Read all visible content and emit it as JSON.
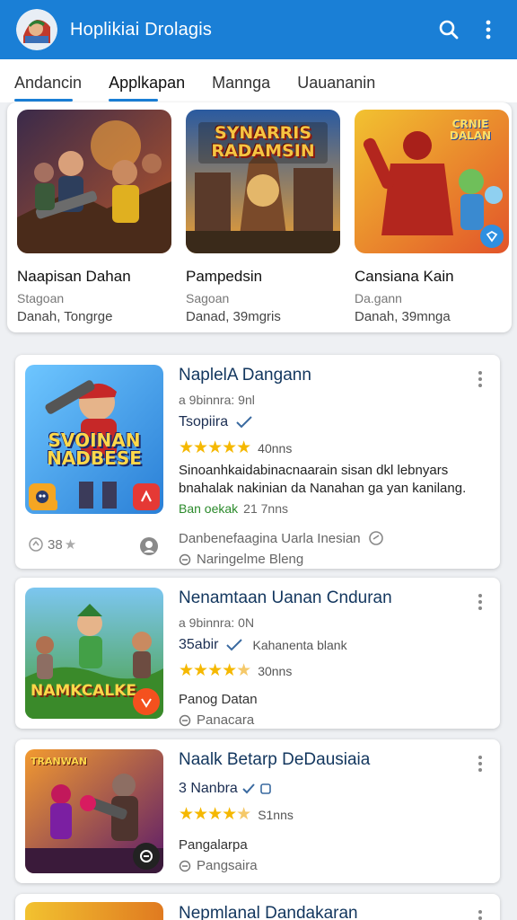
{
  "app": {
    "title": "Hoplikiai Drolagis",
    "logo_icon": "app-logo-icon"
  },
  "toolbar": {
    "search_icon": "search-icon",
    "more_icon": "more-vertical-icon"
  },
  "tabs": [
    {
      "label": "Andancin",
      "active": false,
      "underline": true
    },
    {
      "label": "Applkapan",
      "active": true,
      "underline": true
    },
    {
      "label": "Mannga",
      "active": false,
      "underline": false
    },
    {
      "label": "Uauananin",
      "active": false,
      "underline": false
    }
  ],
  "featured": [
    {
      "title": "Naapisan Dahan",
      "meta": "Stagoan",
      "meta2": "Danah, Tongrge",
      "banner": ""
    },
    {
      "title": "Pampedsin",
      "meta": "Sagoan",
      "meta2": "Danad, 39mgris",
      "banner": "SYNARRIS RADAMSIN"
    },
    {
      "title": "Cansiana Kain",
      "meta": "Da.gann",
      "meta2": "Danah, 39mnga",
      "banner": "CRNIE DALAN"
    }
  ],
  "cards": [
    {
      "title": "NaplelA Dangann",
      "sub": "a 9binnra: 9nl",
      "row": "Tsopiira",
      "row_small": "",
      "rating_count": "40nns",
      "stars": "★★★★★",
      "rating": 5,
      "desc": "Sinoanhkaidabinacnaarain sisan dkl lebnyars bnahalak nakinian da Nanahan ga yan kanilang.",
      "green": "Ban oekak",
      "green2": "21 7nns",
      "gray1": "Danbenefaagina Uarla Inesian",
      "gray2": "Naringelme Bleng",
      "footer_count": "38",
      "thumb_text": "SVOINAN NADBESE"
    },
    {
      "title": "Nenamtaan Uanan Cnduran",
      "sub": "a 9binnra: 0N",
      "row": "35abir",
      "row_small": "Kahanenta blank",
      "rating_count": "30nns",
      "stars": "★★★★",
      "rating": 4.5,
      "desc": "",
      "green": "",
      "green2": "",
      "gray1": "Panog Datan",
      "gray2": "Panacara",
      "footer_count": "",
      "thumb_text": "NAMKCALKE"
    },
    {
      "title": "Naalk Betarp DeDausiaia",
      "sub": "3 Nanbra",
      "row": "",
      "row_small": "",
      "rating_count": "S1nns",
      "stars": "★★★★",
      "rating": 4.5,
      "desc": "",
      "green": "",
      "green2": "",
      "gray1": "Pangalarpa",
      "gray2": "Pangsaira",
      "footer_count": "",
      "thumb_text": "TRANWAN"
    },
    {
      "title": "Nepmlanal Dandakaran",
      "sub": "",
      "row": "",
      "row_small": "",
      "rating_count": "",
      "stars": "",
      "rating": 0,
      "desc": "",
      "green": "",
      "green2": "",
      "gray1": "",
      "gray2": "",
      "footer_count": "",
      "thumb_text": ""
    }
  ],
  "colors": {
    "primary": "#1a7fd6",
    "title_text": "#12365e",
    "star": "#f5b800",
    "background": "#eef0f3"
  }
}
